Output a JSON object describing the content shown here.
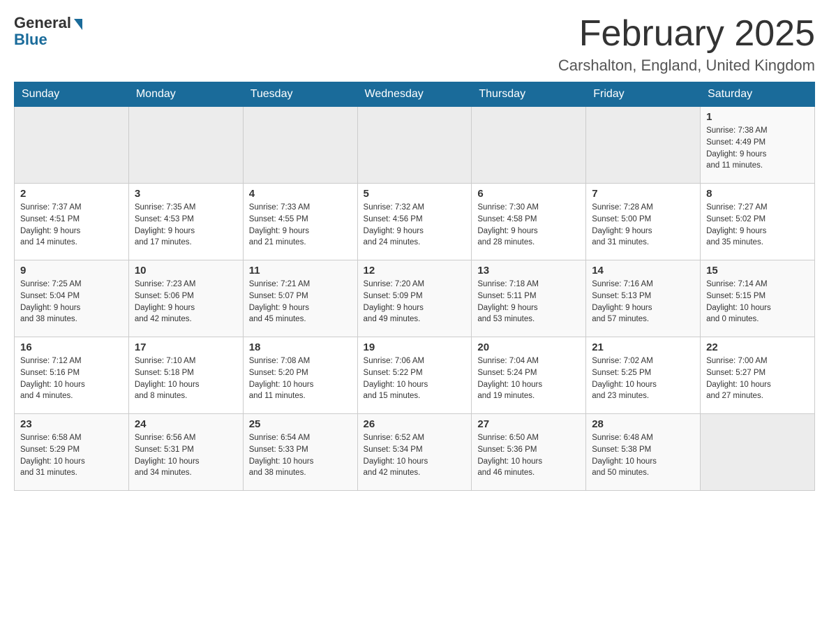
{
  "header": {
    "logo_general": "General",
    "logo_blue": "Blue",
    "month_title": "February 2025",
    "location": "Carshalton, England, United Kingdom"
  },
  "weekdays": [
    "Sunday",
    "Monday",
    "Tuesday",
    "Wednesday",
    "Thursday",
    "Friday",
    "Saturday"
  ],
  "weeks": [
    {
      "days": [
        {
          "num": "",
          "info": ""
        },
        {
          "num": "",
          "info": ""
        },
        {
          "num": "",
          "info": ""
        },
        {
          "num": "",
          "info": ""
        },
        {
          "num": "",
          "info": ""
        },
        {
          "num": "",
          "info": ""
        },
        {
          "num": "1",
          "info": "Sunrise: 7:38 AM\nSunset: 4:49 PM\nDaylight: 9 hours\nand 11 minutes."
        }
      ]
    },
    {
      "days": [
        {
          "num": "2",
          "info": "Sunrise: 7:37 AM\nSunset: 4:51 PM\nDaylight: 9 hours\nand 14 minutes."
        },
        {
          "num": "3",
          "info": "Sunrise: 7:35 AM\nSunset: 4:53 PM\nDaylight: 9 hours\nand 17 minutes."
        },
        {
          "num": "4",
          "info": "Sunrise: 7:33 AM\nSunset: 4:55 PM\nDaylight: 9 hours\nand 21 minutes."
        },
        {
          "num": "5",
          "info": "Sunrise: 7:32 AM\nSunset: 4:56 PM\nDaylight: 9 hours\nand 24 minutes."
        },
        {
          "num": "6",
          "info": "Sunrise: 7:30 AM\nSunset: 4:58 PM\nDaylight: 9 hours\nand 28 minutes."
        },
        {
          "num": "7",
          "info": "Sunrise: 7:28 AM\nSunset: 5:00 PM\nDaylight: 9 hours\nand 31 minutes."
        },
        {
          "num": "8",
          "info": "Sunrise: 7:27 AM\nSunset: 5:02 PM\nDaylight: 9 hours\nand 35 minutes."
        }
      ]
    },
    {
      "days": [
        {
          "num": "9",
          "info": "Sunrise: 7:25 AM\nSunset: 5:04 PM\nDaylight: 9 hours\nand 38 minutes."
        },
        {
          "num": "10",
          "info": "Sunrise: 7:23 AM\nSunset: 5:06 PM\nDaylight: 9 hours\nand 42 minutes."
        },
        {
          "num": "11",
          "info": "Sunrise: 7:21 AM\nSunset: 5:07 PM\nDaylight: 9 hours\nand 45 minutes."
        },
        {
          "num": "12",
          "info": "Sunrise: 7:20 AM\nSunset: 5:09 PM\nDaylight: 9 hours\nand 49 minutes."
        },
        {
          "num": "13",
          "info": "Sunrise: 7:18 AM\nSunset: 5:11 PM\nDaylight: 9 hours\nand 53 minutes."
        },
        {
          "num": "14",
          "info": "Sunrise: 7:16 AM\nSunset: 5:13 PM\nDaylight: 9 hours\nand 57 minutes."
        },
        {
          "num": "15",
          "info": "Sunrise: 7:14 AM\nSunset: 5:15 PM\nDaylight: 10 hours\nand 0 minutes."
        }
      ]
    },
    {
      "days": [
        {
          "num": "16",
          "info": "Sunrise: 7:12 AM\nSunset: 5:16 PM\nDaylight: 10 hours\nand 4 minutes."
        },
        {
          "num": "17",
          "info": "Sunrise: 7:10 AM\nSunset: 5:18 PM\nDaylight: 10 hours\nand 8 minutes."
        },
        {
          "num": "18",
          "info": "Sunrise: 7:08 AM\nSunset: 5:20 PM\nDaylight: 10 hours\nand 11 minutes."
        },
        {
          "num": "19",
          "info": "Sunrise: 7:06 AM\nSunset: 5:22 PM\nDaylight: 10 hours\nand 15 minutes."
        },
        {
          "num": "20",
          "info": "Sunrise: 7:04 AM\nSunset: 5:24 PM\nDaylight: 10 hours\nand 19 minutes."
        },
        {
          "num": "21",
          "info": "Sunrise: 7:02 AM\nSunset: 5:25 PM\nDaylight: 10 hours\nand 23 minutes."
        },
        {
          "num": "22",
          "info": "Sunrise: 7:00 AM\nSunset: 5:27 PM\nDaylight: 10 hours\nand 27 minutes."
        }
      ]
    },
    {
      "days": [
        {
          "num": "23",
          "info": "Sunrise: 6:58 AM\nSunset: 5:29 PM\nDaylight: 10 hours\nand 31 minutes."
        },
        {
          "num": "24",
          "info": "Sunrise: 6:56 AM\nSunset: 5:31 PM\nDaylight: 10 hours\nand 34 minutes."
        },
        {
          "num": "25",
          "info": "Sunrise: 6:54 AM\nSunset: 5:33 PM\nDaylight: 10 hours\nand 38 minutes."
        },
        {
          "num": "26",
          "info": "Sunrise: 6:52 AM\nSunset: 5:34 PM\nDaylight: 10 hours\nand 42 minutes."
        },
        {
          "num": "27",
          "info": "Sunrise: 6:50 AM\nSunset: 5:36 PM\nDaylight: 10 hours\nand 46 minutes."
        },
        {
          "num": "28",
          "info": "Sunrise: 6:48 AM\nSunset: 5:38 PM\nDaylight: 10 hours\nand 50 minutes."
        },
        {
          "num": "",
          "info": ""
        }
      ]
    }
  ]
}
